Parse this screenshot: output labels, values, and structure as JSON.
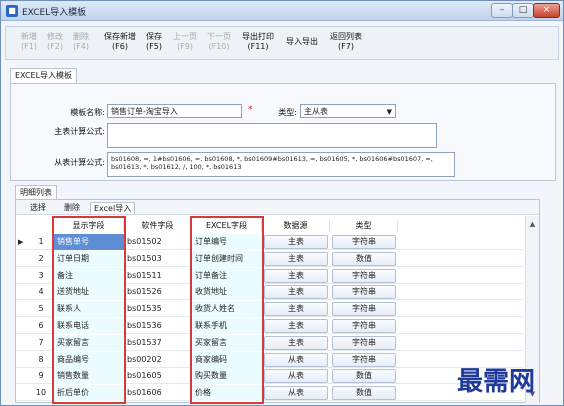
{
  "window": {
    "title": "EXCEL导入模板"
  },
  "titlebar_buttons": {
    "min": "–",
    "max": "□",
    "close": "×"
  },
  "toolbar": [
    {
      "label": "新增",
      "shortcut": "(F1)",
      "enabled": false
    },
    {
      "label": "修改",
      "shortcut": "(F2)",
      "enabled": false
    },
    {
      "label": "删除",
      "shortcut": "(F4)",
      "enabled": false
    },
    {
      "label": "保存新增",
      "shortcut": "(F6)",
      "enabled": true
    },
    {
      "label": "保存",
      "shortcut": "(F5)",
      "enabled": true
    },
    {
      "label": "上一页",
      "shortcut": "(F9)",
      "enabled": false
    },
    {
      "label": "下一页",
      "shortcut": "(F10)",
      "enabled": false
    },
    {
      "label": "导出打印",
      "shortcut": "(F11)",
      "enabled": true
    },
    {
      "label": "导入导出",
      "shortcut": "",
      "enabled": true
    },
    {
      "label": "返回列表",
      "shortcut": "(F7)",
      "enabled": true
    }
  ],
  "main_tab": "EXCEL导入模板",
  "form": {
    "template_name_label": "模板名称:",
    "template_name_value": "销售订单-淘宝导入",
    "required_mark": "*",
    "type_label": "类型:",
    "type_value": "主从表",
    "main_formula_label": "主表计算公式:",
    "main_formula_value": "",
    "detail_formula_label": "从表计算公式:",
    "detail_formula_value": "bs01608, =, 1#bs01606, =, bs01608, *, bs01609#bs01613, =, bs01605, *, bs01606#bs01607, =, bs01613, *, bs01612, /, 100, *, bs01613"
  },
  "detail_tab": "明细列表",
  "sub_tabs": {
    "select": "选择",
    "delete": "删除",
    "excel_import": "Excel导入"
  },
  "grid": {
    "headers": [
      "显示字段",
      "软件字段",
      "EXCEL字段",
      "数据源",
      "类型"
    ],
    "rows": [
      {
        "no": "1",
        "disp": "销售单号",
        "soft": "bs01502",
        "excel": "订单编号",
        "src": "主表",
        "type": "字符串"
      },
      {
        "no": "2",
        "disp": "订单日期",
        "soft": "bs01503",
        "excel": "订单创建时间",
        "src": "主表",
        "type": "数值"
      },
      {
        "no": "3",
        "disp": "备注",
        "soft": "bs01511",
        "excel": "订单备注",
        "src": "主表",
        "type": "字符串"
      },
      {
        "no": "4",
        "disp": "送货地址",
        "soft": "bs01526",
        "excel": "收货地址",
        "src": "主表",
        "type": "字符串"
      },
      {
        "no": "5",
        "disp": "联系人",
        "soft": "bs01535",
        "excel": "收货人姓名",
        "src": "主表",
        "type": "字符串"
      },
      {
        "no": "6",
        "disp": "联系电话",
        "soft": "bs01536",
        "excel": "联系手机",
        "src": "主表",
        "type": "字符串"
      },
      {
        "no": "7",
        "disp": "买家留言",
        "soft": "bs01537",
        "excel": "买家留言",
        "src": "主表",
        "type": "字符串"
      },
      {
        "no": "8",
        "disp": "商品编号",
        "soft": "bs00202",
        "excel": "商家编码",
        "src": "从表",
        "type": "字符串"
      },
      {
        "no": "9",
        "disp": "销售数量",
        "soft": "bs01605",
        "excel": "购买数量",
        "src": "从表",
        "type": "数值"
      },
      {
        "no": "10",
        "disp": "折后单价",
        "soft": "bs01606",
        "excel": "价格",
        "src": "从表",
        "type": "数值"
      }
    ]
  },
  "watermark": "最需网"
}
